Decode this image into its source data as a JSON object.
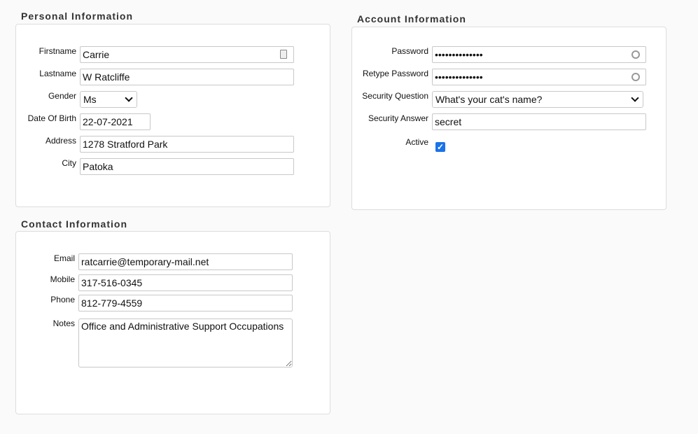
{
  "personal": {
    "title": "Personal Information",
    "firstname_label": "Firstname",
    "firstname": "Carrie",
    "lastname_label": "Lastname",
    "lastname": "W Ratcliffe",
    "gender_label": "Gender",
    "gender": "Ms",
    "dob_label": "Date Of Birth",
    "dob": "22-07-2021",
    "address_label": "Address",
    "address": "1278 Stratford Park",
    "city_label": "City",
    "city": "Patoka"
  },
  "account": {
    "title": "Account Information",
    "password_label": "Password",
    "password": "••••••••••••••",
    "retype_label": "Retype Password",
    "retype": "••••••••••••••",
    "question_label": "Security Question",
    "question": "What's your cat's name?",
    "answer_label": "Security Answer",
    "answer": "secret",
    "active_label": "Active",
    "active": true,
    "accent": "#1a73e8"
  },
  "contact": {
    "title": "Contact Information",
    "email_label": "Email",
    "email": "ratcarrie@temporary-mail.net",
    "mobile_label": "Mobile",
    "mobile": "317-516-0345",
    "phone_label": "Phone",
    "phone": "812-779-4559",
    "notes_label": "Notes",
    "notes": "Office and Administrative Support Occupations"
  }
}
